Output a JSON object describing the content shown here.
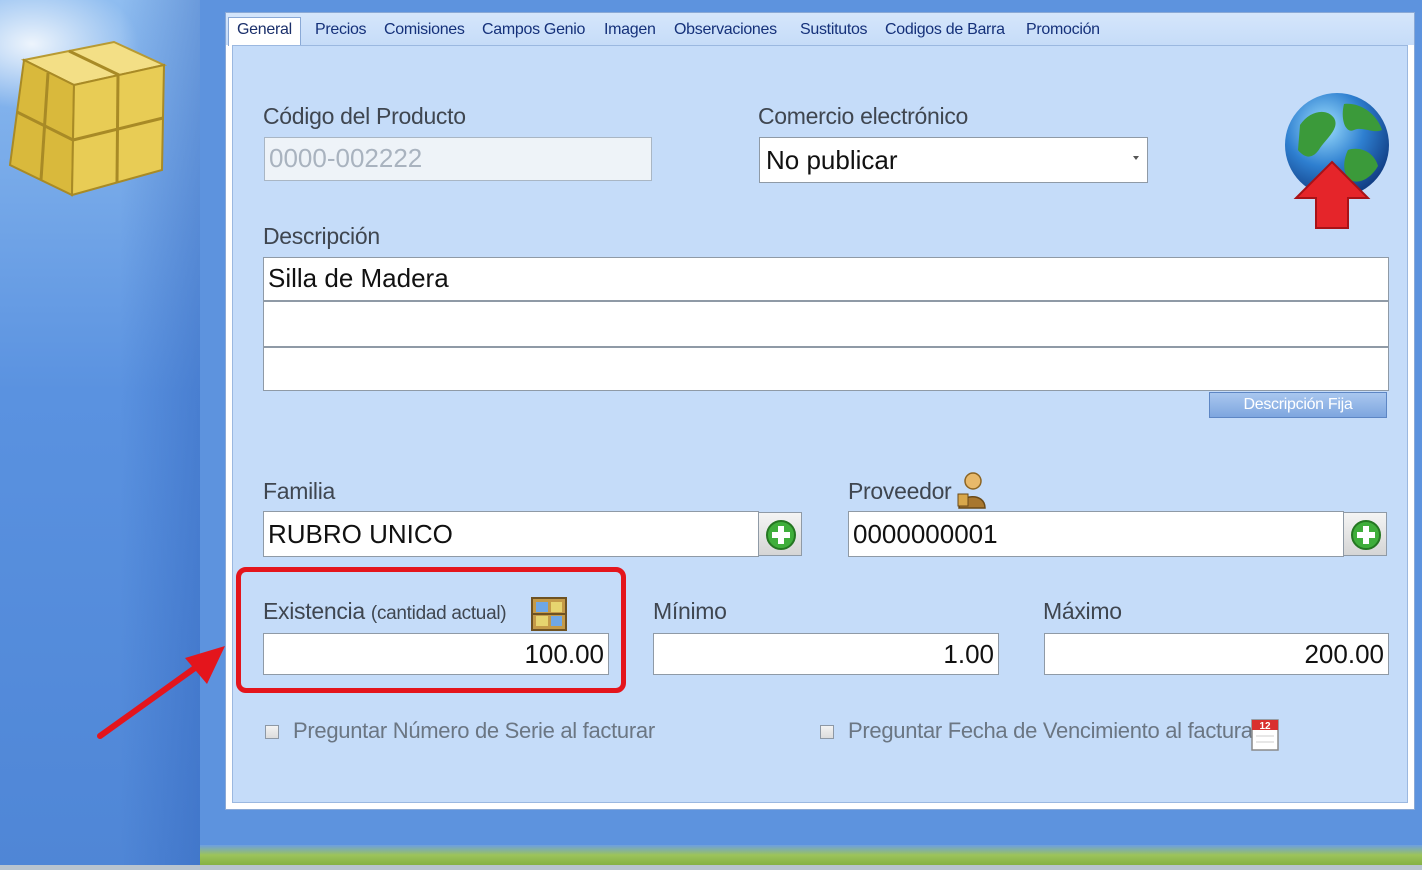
{
  "tabs": [
    {
      "label": "General",
      "active": true
    },
    {
      "label": "Precios"
    },
    {
      "label": "Comisiones"
    },
    {
      "label": "Campos Genio"
    },
    {
      "label": "Imagen"
    },
    {
      "label": "Observaciones"
    },
    {
      "label": "Sustitutos"
    },
    {
      "label": "Codigos de Barra"
    },
    {
      "label": "Promoción"
    }
  ],
  "form": {
    "codigo_label": "Código del Producto",
    "codigo_value": "0000-002222",
    "ecommerce_label": "Comercio electrónico",
    "ecommerce_value": "No publicar",
    "descripcion_label": "Descripción",
    "descripcion_line1": "Silla de Madera",
    "descripcion_line2": "",
    "descripcion_line3": "",
    "descripcion_fija_button": "Descripción Fija",
    "familia_label": "Familia",
    "familia_value": "RUBRO UNICO",
    "proveedor_label": "Proveedor",
    "proveedor_value": "0000000001",
    "existencia_label": "Existencia",
    "existencia_sublabel": "(cantidad actual)",
    "existencia_value": "100.00",
    "minimo_label": "Mínimo",
    "minimo_value": "1.00",
    "maximo_label": "Máximo",
    "maximo_value": "200.00",
    "serie_checkbox_label": "Preguntar Número de Serie al facturar",
    "serie_checked": false,
    "vencimiento_checkbox_label": "Preguntar Fecha de Vencimiento al facturar",
    "vencimiento_checked": false,
    "calendar_day": "12"
  },
  "colors": {
    "highlight_border": "#e4151c",
    "annotation_arrow": "#e4151c",
    "content_background": "#c5dcf9"
  },
  "icons": {
    "app_logo": "yellow-box-icon",
    "publish": "globe-upload-icon",
    "proveedor": "user-icon",
    "existencia": "inventory-shelf-icon",
    "add": "green-plus-icon",
    "vencimiento": "calendar-icon"
  }
}
